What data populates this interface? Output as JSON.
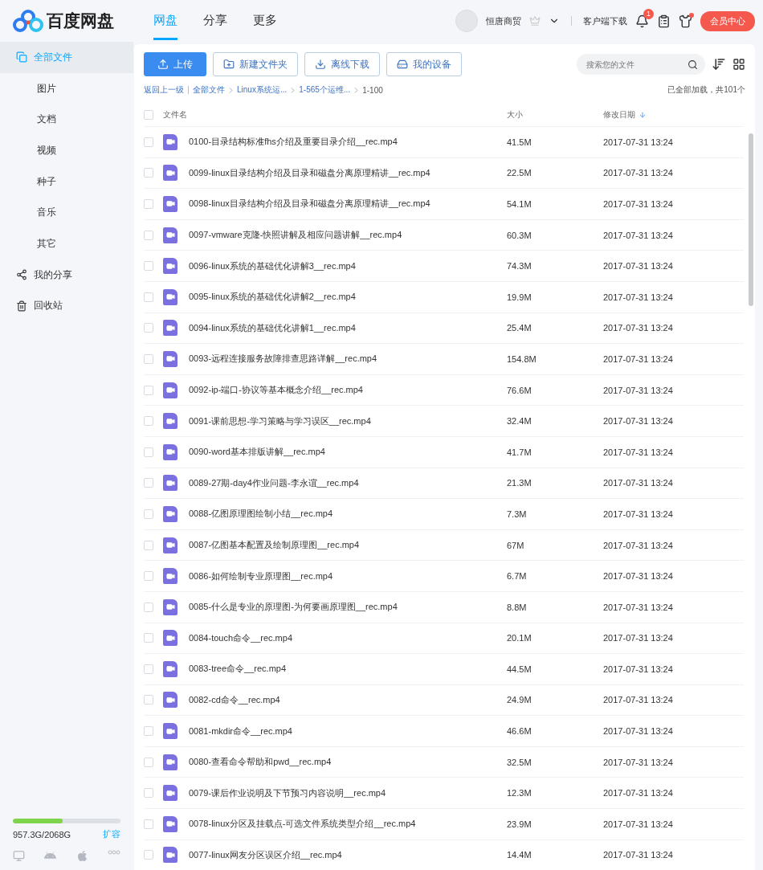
{
  "logo": {
    "text": "百度网盘"
  },
  "nav": [
    {
      "label": "网盘",
      "selected": true
    },
    {
      "label": "分享",
      "selected": false
    },
    {
      "label": "更多",
      "selected": false
    }
  ],
  "user": {
    "name": "恒唐商贸",
    "download": "客户端下载",
    "notification_count": "1",
    "vip_button": "会员中心"
  },
  "sidebar": {
    "items": [
      {
        "label": "全部文件",
        "selected": true,
        "children": [
          {
            "label": "图片",
            "selected": false
          },
          {
            "label": "文档",
            "selected": false
          },
          {
            "label": "视频",
            "selected": false
          },
          {
            "label": "种子",
            "selected": false
          },
          {
            "label": "音乐",
            "selected": false
          },
          {
            "label": "其它",
            "selected": false
          }
        ]
      },
      {
        "label": "我的分享",
        "selected": false
      },
      {
        "label": "回收站",
        "selected": false
      }
    ],
    "storage": {
      "level": 0.46,
      "text": "957.3G/2068G",
      "expand": "扩容"
    }
  },
  "toolbar": {
    "buttons": [
      {
        "label": "上传",
        "kind": "primary"
      },
      {
        "label": "新建文件夹",
        "kind": "outline"
      },
      {
        "label": "离线下载",
        "kind": "outline"
      },
      {
        "label": "我的设备",
        "kind": "outline"
      }
    ],
    "search": {
      "placeholder": "搜索您的文件"
    }
  },
  "breadcrumb": {
    "back": "返回上一级",
    "items": [
      "全部文件",
      "Linux系统运...",
      "1-565个运维...",
      "1-100"
    ],
    "status": "已全部加载，共101个"
  },
  "table": {
    "all_checked": false,
    "columns": [
      "文件名",
      "大小",
      "修改日期"
    ],
    "rows": [
      {
        "name": "0100-目录结构标准fhs介绍及重要目录介绍__rec.mp4",
        "size": "41.5M",
        "date": "2017-07-31 13:24",
        "checked": false
      },
      {
        "name": "0099-linux目录结构介绍及目录和磁盘分离原理精讲__rec.mp4",
        "size": "22.5M",
        "date": "2017-07-31 13:24",
        "checked": false
      },
      {
        "name": "0098-linux目录结构介绍及目录和磁盘分离原理精讲__rec.mp4",
        "size": "54.1M",
        "date": "2017-07-31 13:24",
        "checked": false
      },
      {
        "name": "0097-vmware克隆-快照讲解及相应问题讲解__rec.mp4",
        "size": "60.3M",
        "date": "2017-07-31 13:24",
        "checked": false
      },
      {
        "name": "0096-linux系统的基础优化讲解3__rec.mp4",
        "size": "74.3M",
        "date": "2017-07-31 13:24",
        "checked": false
      },
      {
        "name": "0095-linux系统的基础优化讲解2__rec.mp4",
        "size": "19.9M",
        "date": "2017-07-31 13:24",
        "checked": false
      },
      {
        "name": "0094-linux系统的基础优化讲解1__rec.mp4",
        "size": "25.4M",
        "date": "2017-07-31 13:24",
        "checked": false
      },
      {
        "name": "0093-远程连接服务故障排查思路详解__rec.mp4",
        "size": "154.8M",
        "date": "2017-07-31 13:24",
        "checked": false
      },
      {
        "name": "0092-ip-端口-协议等基本概念介绍__rec.mp4",
        "size": "76.6M",
        "date": "2017-07-31 13:24",
        "checked": false
      },
      {
        "name": "0091-课前思想-学习策略与学习误区__rec.mp4",
        "size": "32.4M",
        "date": "2017-07-31 13:24",
        "checked": false
      },
      {
        "name": "0090-word基本排版讲解__rec.mp4",
        "size": "41.7M",
        "date": "2017-07-31 13:24",
        "checked": false
      },
      {
        "name": "0089-27期-day4作业问题-李永谊__rec.mp4",
        "size": "21.3M",
        "date": "2017-07-31 13:24",
        "checked": false
      },
      {
        "name": "0088-亿图原理图绘制小结__rec.mp4",
        "size": "7.3M",
        "date": "2017-07-31 13:24",
        "checked": false
      },
      {
        "name": "0087-亿图基本配置及绘制原理图__rec.mp4",
        "size": "67M",
        "date": "2017-07-31 13:24",
        "checked": false
      },
      {
        "name": "0086-如何绘制专业原理图__rec.mp4",
        "size": "6.7M",
        "date": "2017-07-31 13:24",
        "checked": false
      },
      {
        "name": "0085-什么是专业的原理图-为何要画原理图__rec.mp4",
        "size": "8.8M",
        "date": "2017-07-31 13:24",
        "checked": false
      },
      {
        "name": "0084-touch命令__rec.mp4",
        "size": "20.1M",
        "date": "2017-07-31 13:24",
        "checked": false
      },
      {
        "name": "0083-tree命令__rec.mp4",
        "size": "44.5M",
        "date": "2017-07-31 13:24",
        "checked": false
      },
      {
        "name": "0082-cd命令__rec.mp4",
        "size": "24.9M",
        "date": "2017-07-31 13:24",
        "checked": false
      },
      {
        "name": "0081-mkdir命令__rec.mp4",
        "size": "46.6M",
        "date": "2017-07-31 13:24",
        "checked": false
      },
      {
        "name": "0080-查看命令帮助和pwd__rec.mp4",
        "size": "32.5M",
        "date": "2017-07-31 13:24",
        "checked": false
      },
      {
        "name": "0079-课后作业说明及下节预习内容说明__rec.mp4",
        "size": "12.3M",
        "date": "2017-07-31 13:24",
        "checked": false
      },
      {
        "name": "0078-linux分区及挂载点-可选文件系统类型介绍__rec.mp4",
        "size": "23.9M",
        "date": "2017-07-31 13:24",
        "checked": false
      },
      {
        "name": "0077-linux网友分区误区介绍__rec.mp4",
        "size": "14.4M",
        "date": "2017-07-31 13:24",
        "checked": false
      }
    ]
  }
}
